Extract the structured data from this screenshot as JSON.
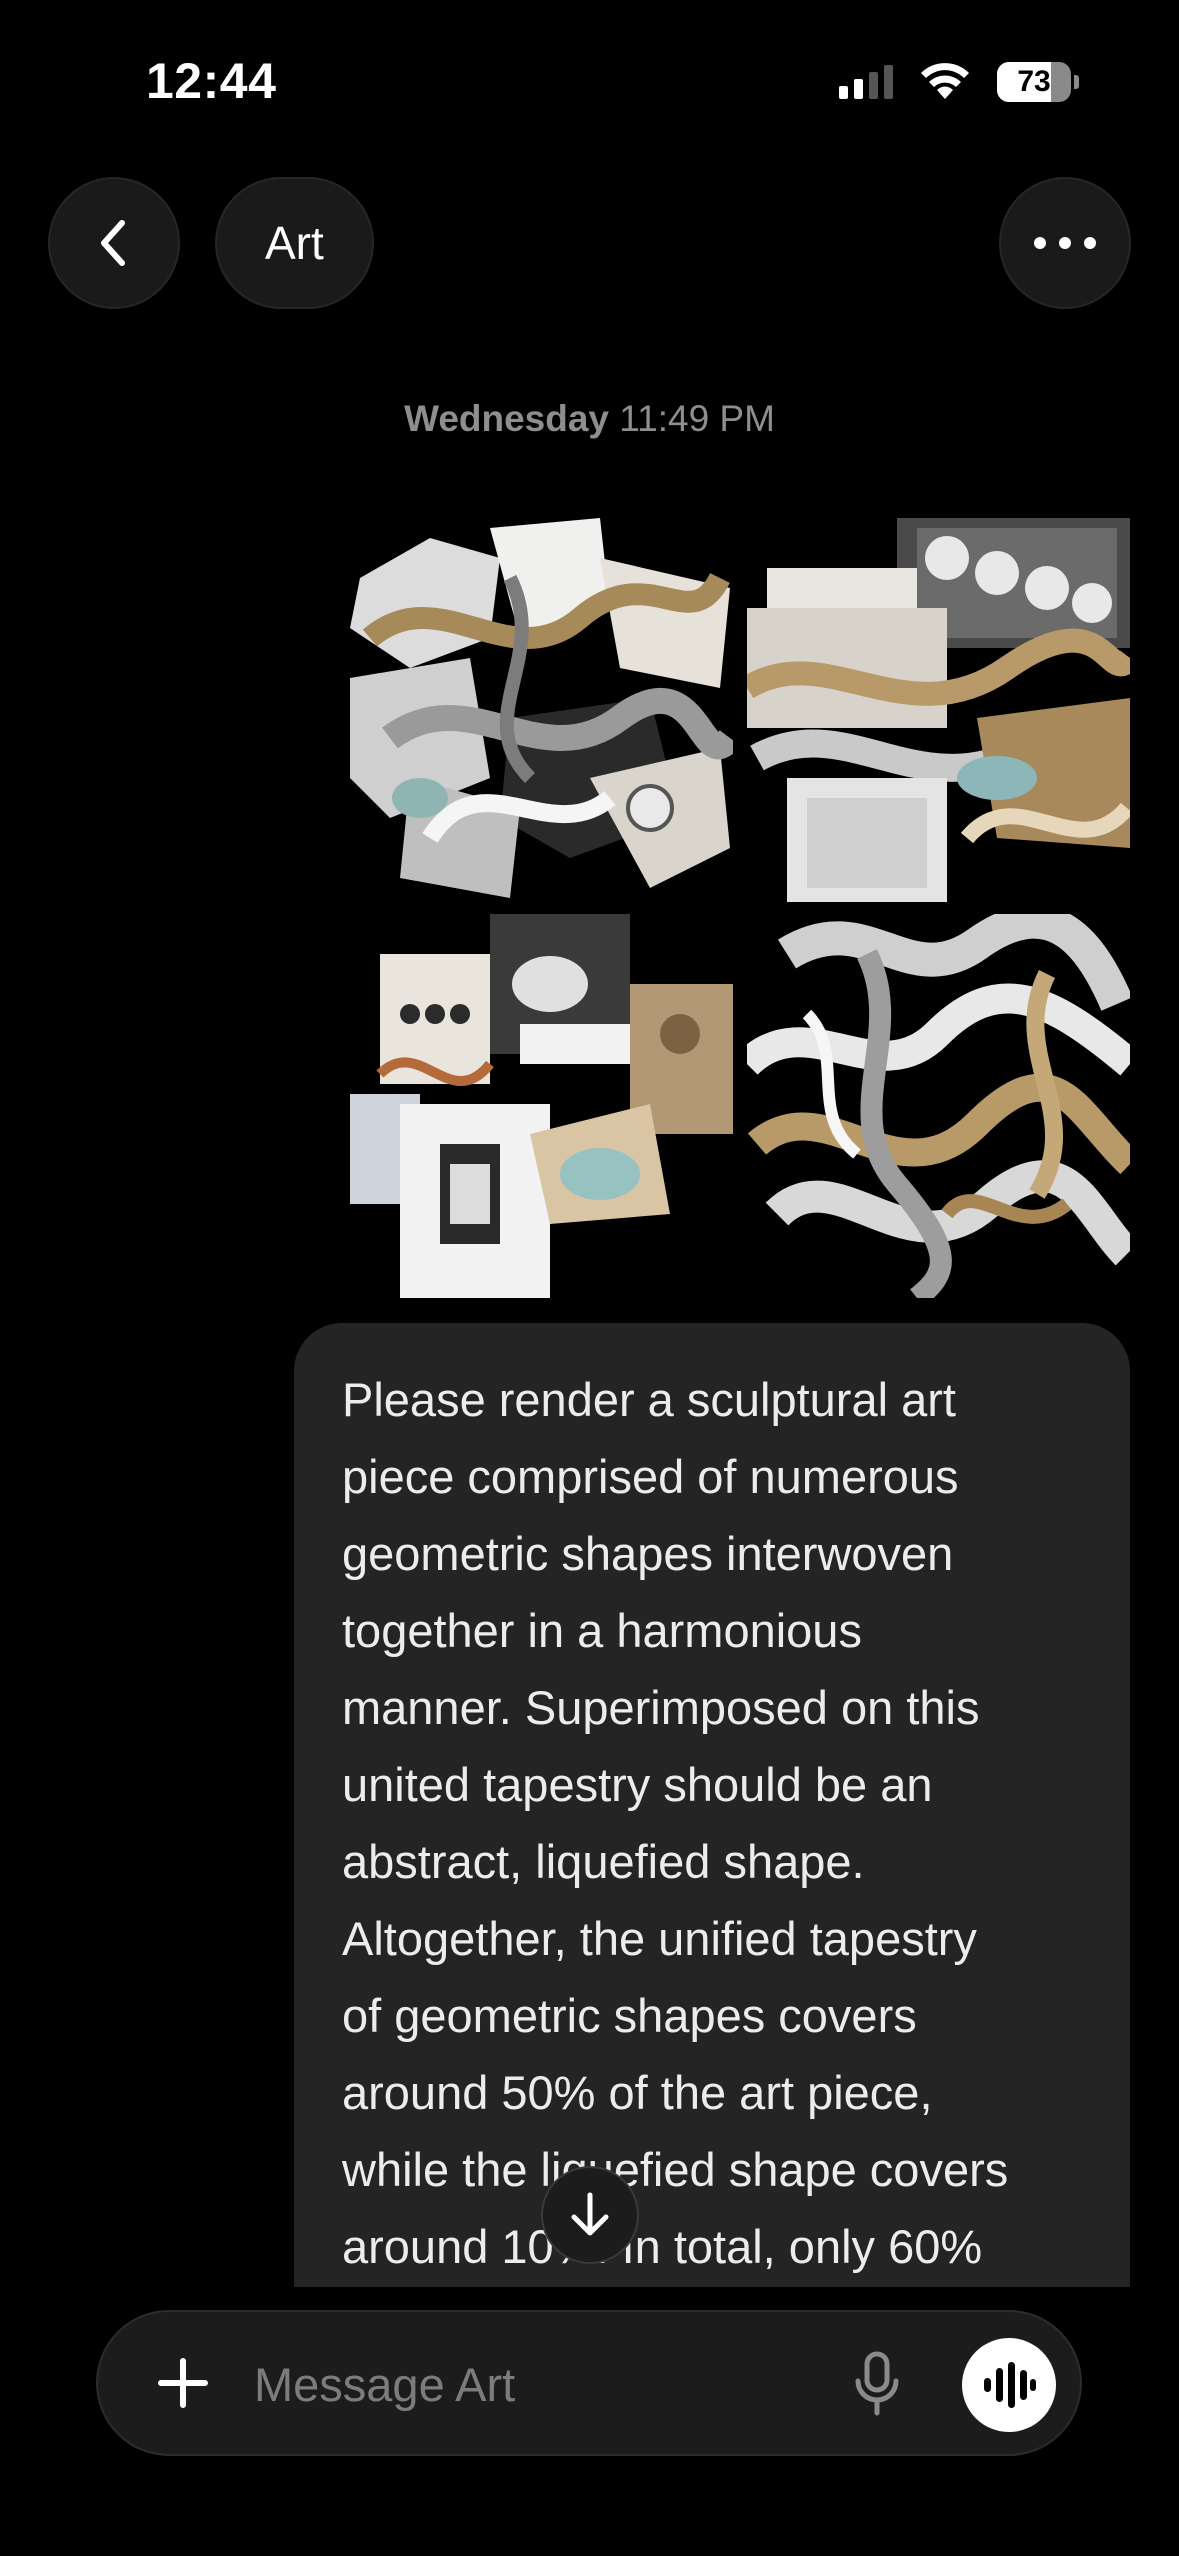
{
  "status_bar": {
    "time": "12:44",
    "battery": "73",
    "battery_level": 0.73,
    "signal_bars": 2,
    "icons": [
      "cellular-signal-icon",
      "wifi-icon",
      "battery-icon"
    ]
  },
  "header": {
    "title": "Art",
    "back_icon": "chevron-left-icon",
    "more_icon": "ellipsis-icon"
  },
  "conversation": {
    "timestamp_day": "Wednesday",
    "timestamp_time": "11:49 PM",
    "attachments": [
      {
        "kind": "image",
        "name": "chrome-geometric-collage"
      },
      {
        "kind": "image",
        "name": "layered-metal-sheets-collage"
      },
      {
        "kind": "image",
        "name": "mixed-media-photo-collage"
      },
      {
        "kind": "image",
        "name": "liquefied-chrome-shape"
      }
    ],
    "message_lines": [
      "Please render a sculptural art",
      "piece comprised of numerous",
      "geometric shapes interwoven",
      "together in a harmonious",
      "manner. Superimposed on this",
      "united tapestry should be an",
      "abstract, liquefied shape.",
      "Altogether, the unified tapestry",
      "of geometric shapes covers",
      "around 50% of the art piece,",
      "while the liquefied shape covers",
      "around 10%. In total, only 60%"
    ],
    "scroll_down_icon": "arrow-down-icon"
  },
  "composer": {
    "placeholder": "Message Art",
    "plus_icon": "plus-icon",
    "mic_icon": "microphone-icon",
    "voice_icon": "voice-waveform-icon"
  },
  "colors": {
    "background": "#000000",
    "bubble": "#242424",
    "control_bg": "#1a1a1a",
    "muted_text": "#8e8e8e"
  }
}
